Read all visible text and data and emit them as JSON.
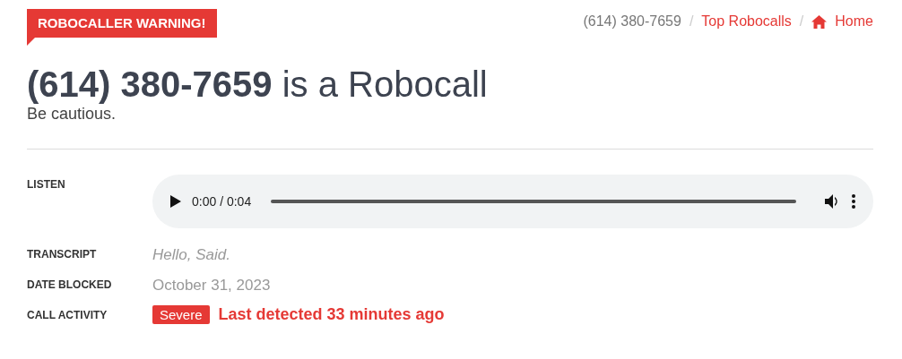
{
  "badge": "ROBOCALLER WARNING!",
  "breadcrumb_separator": "/",
  "breadcrumbs": [
    {
      "label": "(614) 380-7659",
      "kind": "current"
    },
    {
      "label": "Top Robocalls",
      "kind": "link"
    },
    {
      "label": "Home",
      "kind": "home"
    }
  ],
  "heading": {
    "number": "(614) 380-7659",
    "rest": "is a Robocall"
  },
  "subtitle": "Be cautious.",
  "details": [
    {
      "label": "LISTEN",
      "kind": "audio",
      "time": "0:00 / 0:04"
    },
    {
      "label": "TRANSCRIPT",
      "kind": "transcript",
      "value": "Hello, Said."
    },
    {
      "label": "DATE BLOCKED",
      "kind": "date",
      "value": "October 31, 2023"
    },
    {
      "label": "CALL ACTIVITY",
      "kind": "activity",
      "tag": "Severe",
      "value": "Last detected 33 minutes ago"
    }
  ]
}
